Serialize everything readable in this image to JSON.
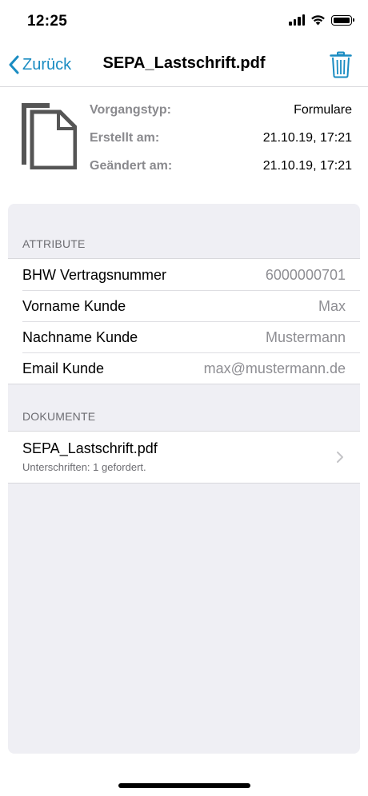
{
  "status_bar": {
    "time": "12:25"
  },
  "nav": {
    "back_label": "Zurück",
    "title": "SEPA_Lastschrift.pdf"
  },
  "info": [
    {
      "label": "Vorgangstyp:",
      "value": "Formulare"
    },
    {
      "label": "Erstellt am:",
      "value": "21.10.19, 17:21"
    },
    {
      "label": "Geändert am:",
      "value": "21.10.19, 17:21"
    }
  ],
  "attributes": {
    "header": "ATTRIBUTE",
    "rows": [
      {
        "label": "BHW Vertragsnummer",
        "value": "6000000701"
      },
      {
        "label": "Vorname Kunde",
        "value": "Max"
      },
      {
        "label": "Nachname Kunde",
        "value": "Mustermann"
      },
      {
        "label": "Email Kunde",
        "value": "max@mustermann.de"
      }
    ]
  },
  "documents": {
    "header": "DOKUMENTE",
    "items": [
      {
        "title": "SEPA_Lastschrift.pdf",
        "subtitle": "Unterschriften: 1 gefordert."
      }
    ]
  },
  "colors": {
    "accent": "#1a8cc2",
    "panel_bg": "#efeff4",
    "secondary_text": "#8e8e93"
  }
}
